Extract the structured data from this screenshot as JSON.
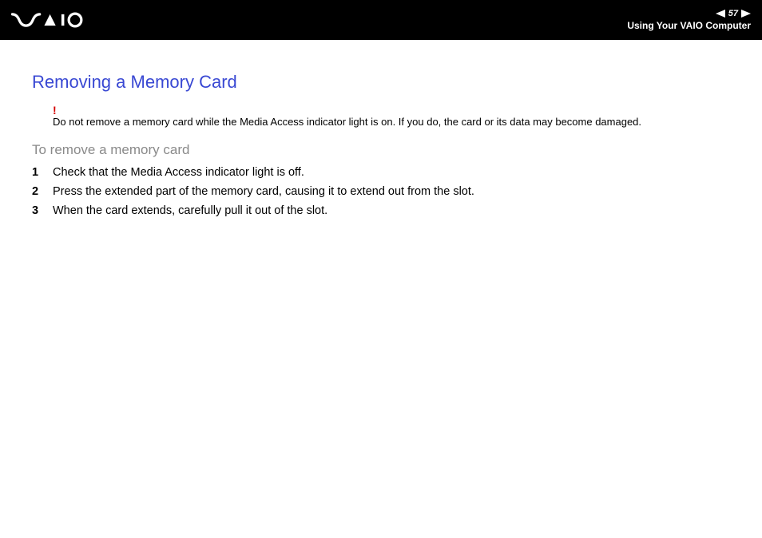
{
  "header": {
    "page_number": "57",
    "caption": "Using Your VAIO Computer"
  },
  "section": {
    "title": "Removing a Memory Card",
    "warning_mark": "!",
    "warning_text": "Do not remove a memory card while the Media Access indicator light is on. If you do, the card or its data may become damaged.",
    "subsection_title": "To remove a memory card",
    "steps": [
      {
        "num": "1",
        "text": "Check that the Media Access indicator light is off."
      },
      {
        "num": "2",
        "text": "Press the extended part of the memory card, causing it to extend out from the slot."
      },
      {
        "num": "3",
        "text": "When the card extends, carefully pull it out of the slot."
      }
    ]
  }
}
